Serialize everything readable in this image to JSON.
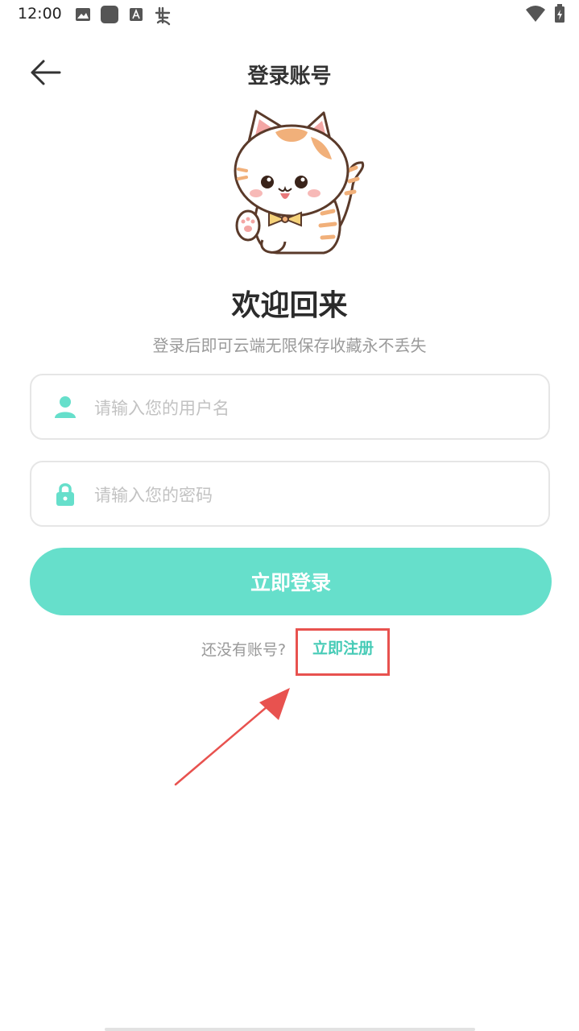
{
  "status_bar": {
    "time": "12:00",
    "icons": [
      "image-icon",
      "square-icon",
      "font-icon",
      "bug-icon",
      "wifi-icon",
      "battery-icon"
    ]
  },
  "header": {
    "back_icon": "arrow-left-icon",
    "title": "登录账号"
  },
  "welcome": {
    "title": "欢迎回来",
    "subtitle": "登录后即可云端无限保存收藏永不丢失"
  },
  "form": {
    "username": {
      "placeholder": "请输入您的用户名",
      "value": "",
      "icon": "user-icon"
    },
    "password": {
      "placeholder": "请输入您的密码",
      "value": "",
      "icon": "lock-icon"
    },
    "login_label": "立即登录"
  },
  "register": {
    "prompt": "还没有账号?",
    "link_label": "立即注册"
  },
  "colors": {
    "accent": "#66dfcb",
    "link": "#46cbb6",
    "annotation": "#e8524f"
  }
}
